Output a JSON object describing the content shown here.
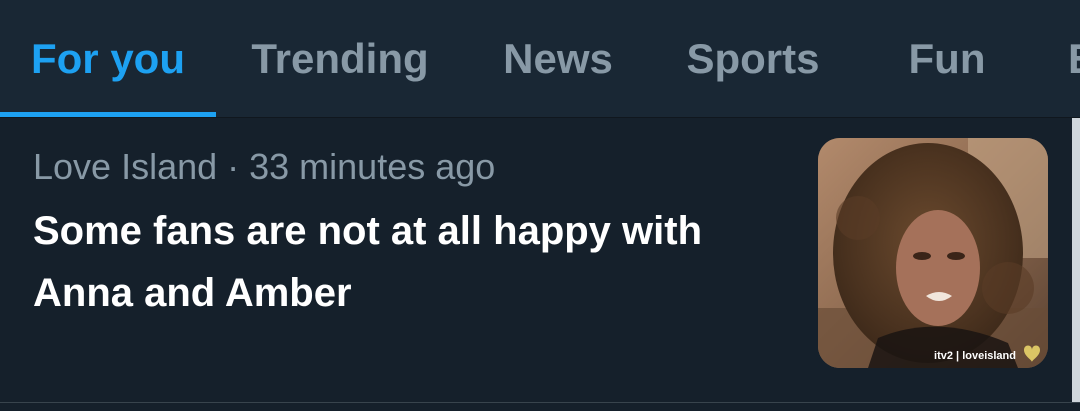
{
  "tabs": [
    {
      "label": "For you",
      "active": true
    },
    {
      "label": "Trending",
      "active": false
    },
    {
      "label": "News",
      "active": false
    },
    {
      "label": "Sports",
      "active": false
    },
    {
      "label": "Fun",
      "active": false
    },
    {
      "label": "E",
      "active": false
    }
  ],
  "story": {
    "source": "Love Island",
    "time": "33 minutes ago",
    "meta": "Love Island · 33 minutes ago",
    "headline": "Some fans are not at all happy with Anna and Amber",
    "watermark": "itv2 | loveisland"
  },
  "colors": {
    "background": "#15202b",
    "tabbar": "#192734",
    "accent": "#1da1f2",
    "muted_text": "#8899a6",
    "headline_text": "#ffffff"
  }
}
